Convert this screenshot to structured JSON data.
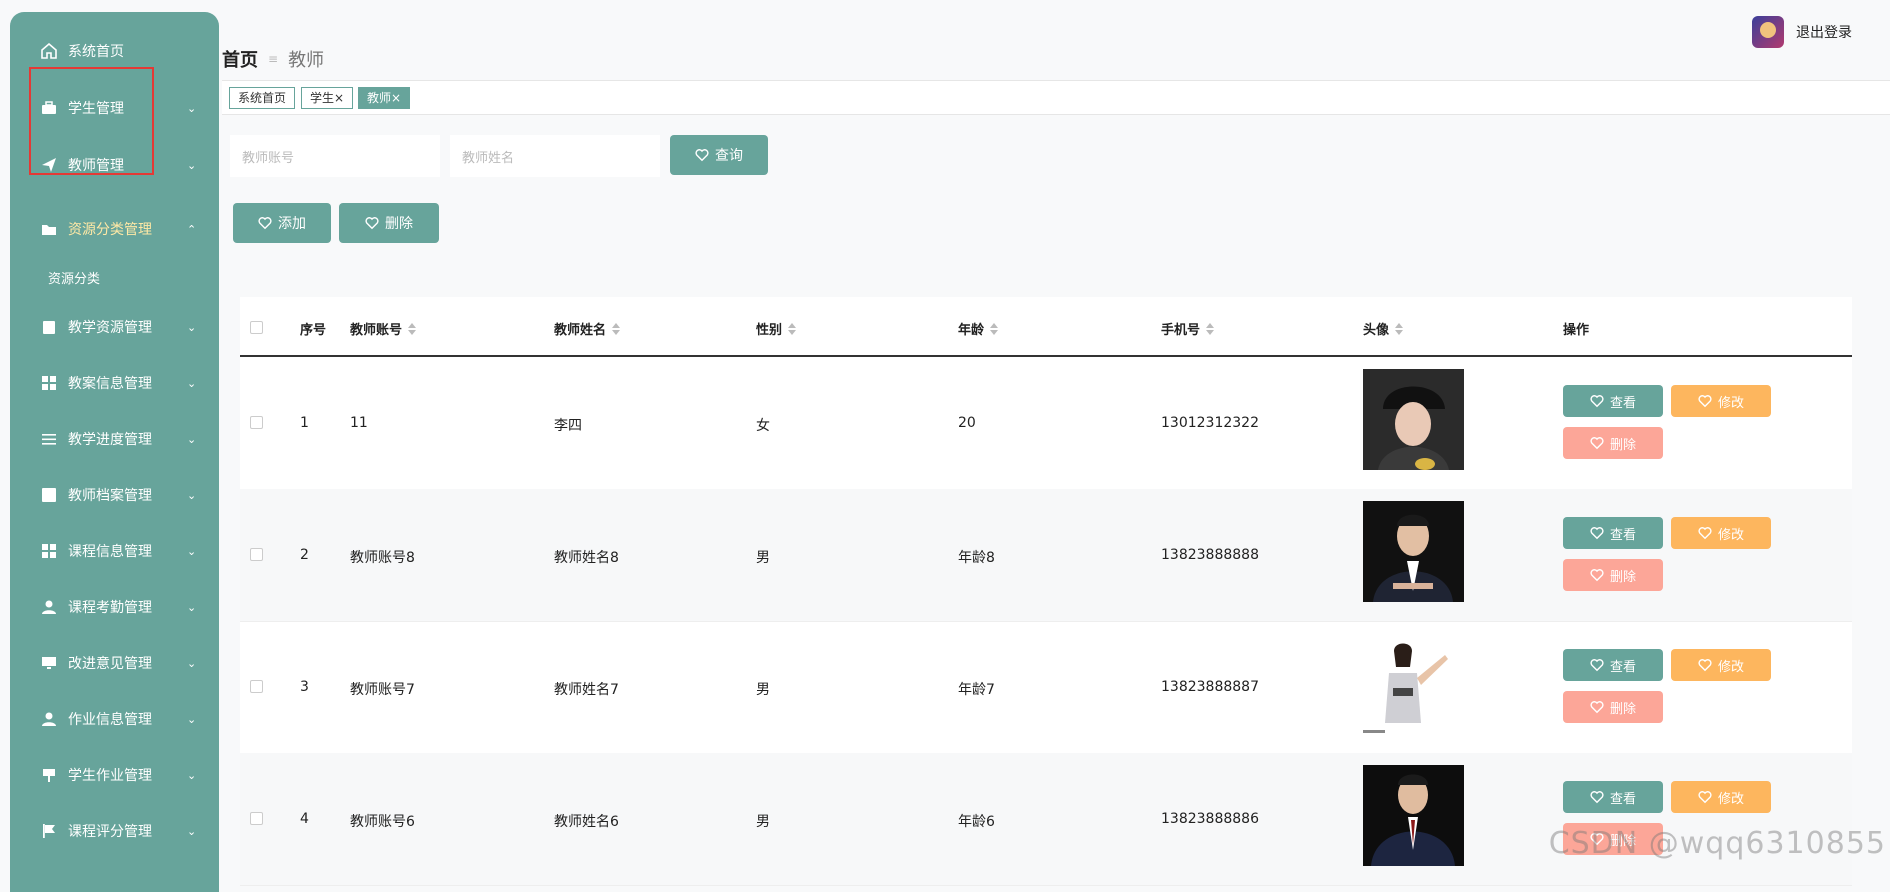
{
  "sidebar": {
    "items": [
      {
        "label": "系统首页",
        "icon": "home-icon",
        "chevron": ""
      },
      {
        "label": "学生管理",
        "icon": "briefcase-icon",
        "chevron": "⌄"
      },
      {
        "label": "教师管理",
        "icon": "send-icon",
        "chevron": "⌄"
      },
      {
        "label": "资源分类管理",
        "icon": "folder-icon",
        "chevron": "⌃"
      },
      {
        "label": "教学资源管理",
        "icon": "clipboard-icon",
        "chevron": "⌄"
      },
      {
        "label": "教案信息管理",
        "icon": "grid-icon",
        "chevron": "⌄"
      },
      {
        "label": "教学进度管理",
        "icon": "sliders-icon",
        "chevron": "⌄"
      },
      {
        "label": "教师档案管理",
        "icon": "chart-icon",
        "chevron": "⌄"
      },
      {
        "label": "课程信息管理",
        "icon": "grid-icon",
        "chevron": "⌄"
      },
      {
        "label": "课程考勤管理",
        "icon": "user-icon",
        "chevron": "⌄"
      },
      {
        "label": "改进意见管理",
        "icon": "monitor-icon",
        "chevron": "⌄"
      },
      {
        "label": "作业信息管理",
        "icon": "user-icon",
        "chevron": "⌄"
      },
      {
        "label": "学生作业管理",
        "icon": "signpost-icon",
        "chevron": "⌄"
      },
      {
        "label": "课程评分管理",
        "icon": "flag-icon",
        "chevron": "⌄"
      }
    ],
    "sub_item": "资源分类"
  },
  "header": {
    "breadcrumb_home": "首页",
    "breadcrumb_sep": "≡",
    "breadcrumb_current": "教师",
    "logout": "退出登录"
  },
  "tabs": [
    "系统首页",
    "学生×",
    "教师×"
  ],
  "search": {
    "account_placeholder": "教师账号",
    "name_placeholder": "教师姓名",
    "query_label": "查询"
  },
  "actions": {
    "add": "添加",
    "delete": "删除"
  },
  "table": {
    "headers": [
      "序号",
      "教师账号",
      "教师姓名",
      "性别",
      "年龄",
      "手机号",
      "头像",
      "操作"
    ],
    "rows": [
      {
        "no": "1",
        "account": "11",
        "name": "李四",
        "gender": "女",
        "age": "20",
        "phone": "13012312322"
      },
      {
        "no": "2",
        "account": "教师账号8",
        "name": "教师姓名8",
        "gender": "男",
        "age": "年龄8",
        "phone": "13823888888"
      },
      {
        "no": "3",
        "account": "教师账号7",
        "name": "教师姓名7",
        "gender": "男",
        "age": "年龄7",
        "phone": "13823888887"
      },
      {
        "no": "4",
        "account": "教师账号6",
        "name": "教师姓名6",
        "gender": "男",
        "age": "年龄6",
        "phone": "13823888886"
      }
    ],
    "row_actions": {
      "view": "查看",
      "edit": "修改",
      "delete": "删除"
    }
  },
  "watermark": "CSDN @wqq6310855",
  "colors": {
    "accent": "#67a49b",
    "orange": "#fdb65e",
    "pink": "#fca698",
    "highlight": "#e53935"
  }
}
